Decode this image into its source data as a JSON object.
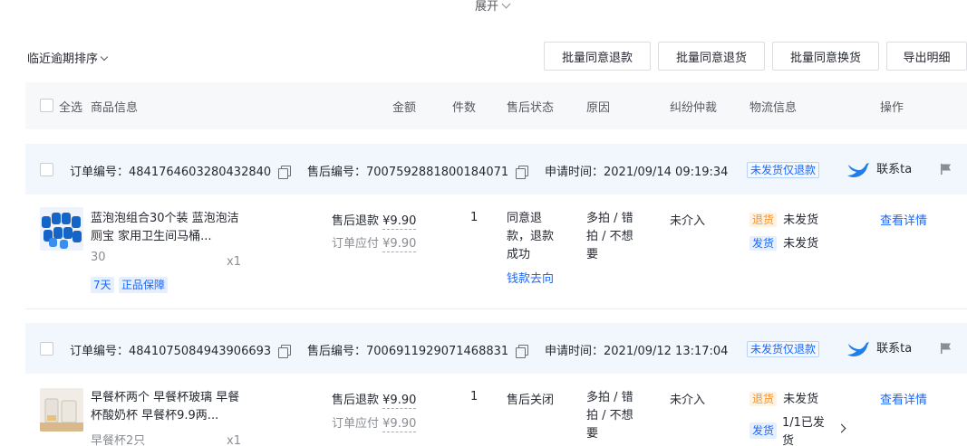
{
  "top": {
    "expand_label": "展开"
  },
  "toolbar": {
    "sort_label": "临近逾期排序",
    "buttons": [
      "批量同意退款",
      "批量同意退货",
      "批量同意换货",
      "导出明细"
    ]
  },
  "table": {
    "select_all": "全选",
    "columns": [
      "商品信息",
      "金额",
      "件数",
      "售后状态",
      "原因",
      "纠纷仲裁",
      "物流信息",
      "操作"
    ]
  },
  "orders": [
    {
      "order_no": "订单编号：4841764603280432840",
      "aftersale_no": "售后编号：7007592881800184071",
      "apply_time": "申请时间：2021/09/14 09:19:34",
      "type_tag": "未发货仅退款",
      "contact": "联系ta",
      "product_name": "蓝泡泡组合30个装 蓝泡泡洁厕宝 家用卫生间马桶...",
      "spec": "30",
      "qty_label": "x1",
      "badges": [
        "7天",
        "正品保障"
      ],
      "refund_label": "售后退款",
      "refund_amount": "¥9.90",
      "payable_label": "订单应付",
      "payable_amount": "¥9.90",
      "count": "1",
      "status": "同意退款，退款成功",
      "status_link": "钱款去向",
      "reason": "多拍 / 错拍 / 不想要",
      "arbitration": "未介入",
      "logistics": [
        {
          "tag": "退货",
          "tag_color": "#ff8f1f",
          "text": "未发货"
        },
        {
          "tag": "发货",
          "tag_color": "#1966ff",
          "text": "未发货"
        }
      ],
      "action": "查看详情"
    },
    {
      "order_no": "订单编号：4841075084943906693",
      "aftersale_no": "售后编号：7006911929071468831",
      "apply_time": "申请时间：2021/09/12 13:17:04",
      "type_tag": "未发货仅退款",
      "contact": "联系ta",
      "product_name": "早餐杯两个 早餐杯玻璃 早餐杯酸奶杯 早餐杯9.9两...",
      "spec": "早餐杯2只",
      "qty_label": "x1",
      "refund_label": "售后退款",
      "refund_amount": "¥9.90",
      "payable_label": "订单应付",
      "payable_amount": "¥9.90",
      "count": "1",
      "status": "售后关闭",
      "reason": "多拍 / 错拍 / 不想要",
      "arbitration": "未介入",
      "logistics": [
        {
          "tag": "退货",
          "tag_color": "#ff8f1f",
          "text": "未发货"
        },
        {
          "tag": "发货",
          "tag_color": "#1966ff",
          "text": "1/1已发货"
        }
      ],
      "action": "查看详情"
    }
  ]
}
